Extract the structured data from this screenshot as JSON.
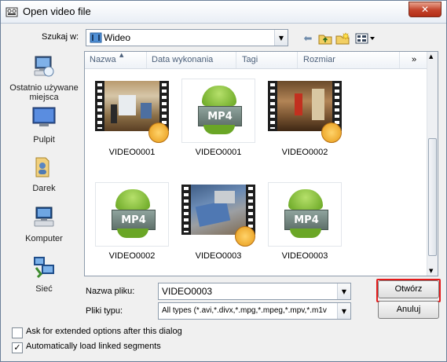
{
  "window": {
    "title": "Open video file",
    "close_glyph": "✕"
  },
  "look_in": {
    "label": "Szukaj w:",
    "value": "Wideo"
  },
  "places": [
    {
      "name": "recent-places",
      "label": "Ostatnio używane miejsca"
    },
    {
      "name": "desktop",
      "label": "Pulpit"
    },
    {
      "name": "user-folder",
      "label": "Darek"
    },
    {
      "name": "computer",
      "label": "Komputer"
    },
    {
      "name": "network",
      "label": "Sieć"
    }
  ],
  "columns": {
    "name": "Nazwa",
    "date": "Data wykonania",
    "tags": "Tagi",
    "size": "Rozmiar",
    "more": "»"
  },
  "files": [
    {
      "name": "VIDEO0001",
      "kind": "video-thumbnail"
    },
    {
      "name": "VIDEO0001",
      "kind": "mp4-icon"
    },
    {
      "name": "VIDEO0002",
      "kind": "video-thumbnail"
    },
    {
      "name": "VIDEO0002",
      "kind": "mp4-icon"
    },
    {
      "name": "VIDEO0003",
      "kind": "video-thumbnail"
    },
    {
      "name": "VIDEO0003",
      "kind": "mp4-icon"
    }
  ],
  "mp4_label": "MP4",
  "filename": {
    "label": "Nazwa pliku:",
    "value": "VIDEO0003"
  },
  "filetype": {
    "label": "Pliki typu:",
    "value": "All types (*.avi,*.divx,*.mpg,*.mpeg,*.mpv,*.m1v"
  },
  "buttons": {
    "open": "Otwórz",
    "cancel": "Anuluj"
  },
  "options": [
    {
      "label": "Ask for extended options after this dialog",
      "checked": false
    },
    {
      "label": "Automatically load linked segments",
      "checked": true
    }
  ],
  "colors": {
    "highlight": "#e31b1b",
    "close": "#c3422a"
  }
}
